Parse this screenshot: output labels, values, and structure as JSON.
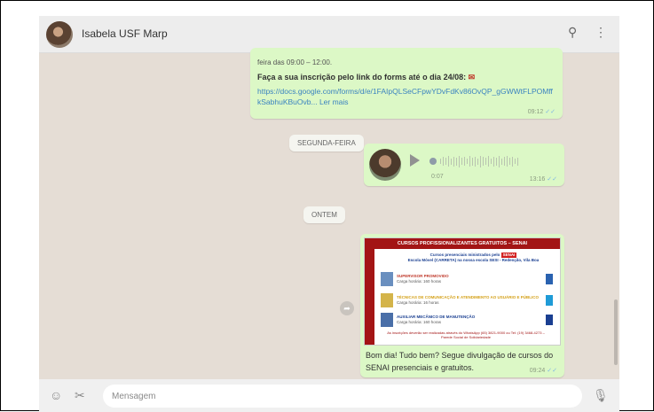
{
  "header": {
    "contact_name": "Isabela USF Marp",
    "icons": [
      "search-icon",
      "menu-icon"
    ]
  },
  "chat": {
    "msg1": {
      "line0": "feira das 09:00 – 12:00.",
      "bold": "Faça a sua inscrição pelo link do forms até o dia 24/08:",
      "link": "https://docs.google.com/forms/d/e/1FAIpQLSeCFpwYDvFdKv86OvQP_gGWWtFLPOMffkSabhuKBuOvb...",
      "more": "Ler mais",
      "time": "09:12"
    },
    "date1": "SEGUNDA-FEIRA",
    "voice": {
      "duration": "0:07",
      "time": "13:16"
    },
    "date2": "ONTEM",
    "flyer": {
      "title": "CURSOS PROFISSIONALIZANTES GRATUITOS – SENAI",
      "sub_line1": "Cursos presenciais ministrados pelo",
      "brand": "SENAI",
      "sub_line2": "Escola Móvel (CARRETA) na nossa escola SESI - Redenção, Vila Boa",
      "items": [
        {
          "title": "SUPERVISOR PROMOVIDO",
          "sub": "Carga horária: 160 horas",
          "color": "#c0392b"
        },
        {
          "title": "TÉCNICAS DE COMUNICAÇÃO E ATENDIMENTO AO USUÁRIO E PÚBLICO",
          "sub": "Carga horária: 16 horas",
          "color": "#d4a017"
        },
        {
          "title": "AUXILIAR MECÂNICO DE MANUTENÇÃO",
          "sub": "Carga horária: 160 horas",
          "color": "#1a3f91"
        }
      ],
      "footer": "As inscrições deverão ser realizadas através do WhatsApp (65) 3821-9000 ou Tel: (19) 3468-4273 – Parede Social de Solidariedade"
    },
    "msg3": {
      "caption": "Bom dia! Tudo bem? Segue divulgação de cursos do SENAI presenciais e gratuitos.",
      "time": "09:24"
    }
  },
  "footer": {
    "placeholder": "Mensagem",
    "icons": [
      "emoji-icon",
      "attach-icon",
      "microphone-icon"
    ]
  }
}
